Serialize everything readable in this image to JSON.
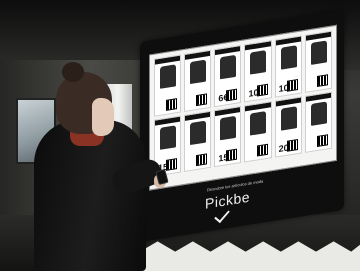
{
  "scene": {
    "ad": {
      "brand": "Pickbe",
      "brand_subtext": "Descubre los artículos de moda"
    },
    "tiles": [
      {
        "price": ""
      },
      {
        "price": ""
      },
      {
        "price": "6€"
      },
      {
        "price": "10€"
      },
      {
        "price": "10€"
      },
      {
        "price": ""
      },
      {
        "price": "15€"
      },
      {
        "price": ""
      },
      {
        "price": "15€"
      },
      {
        "price": ""
      },
      {
        "price": "20€"
      },
      {
        "price": ""
      }
    ]
  }
}
